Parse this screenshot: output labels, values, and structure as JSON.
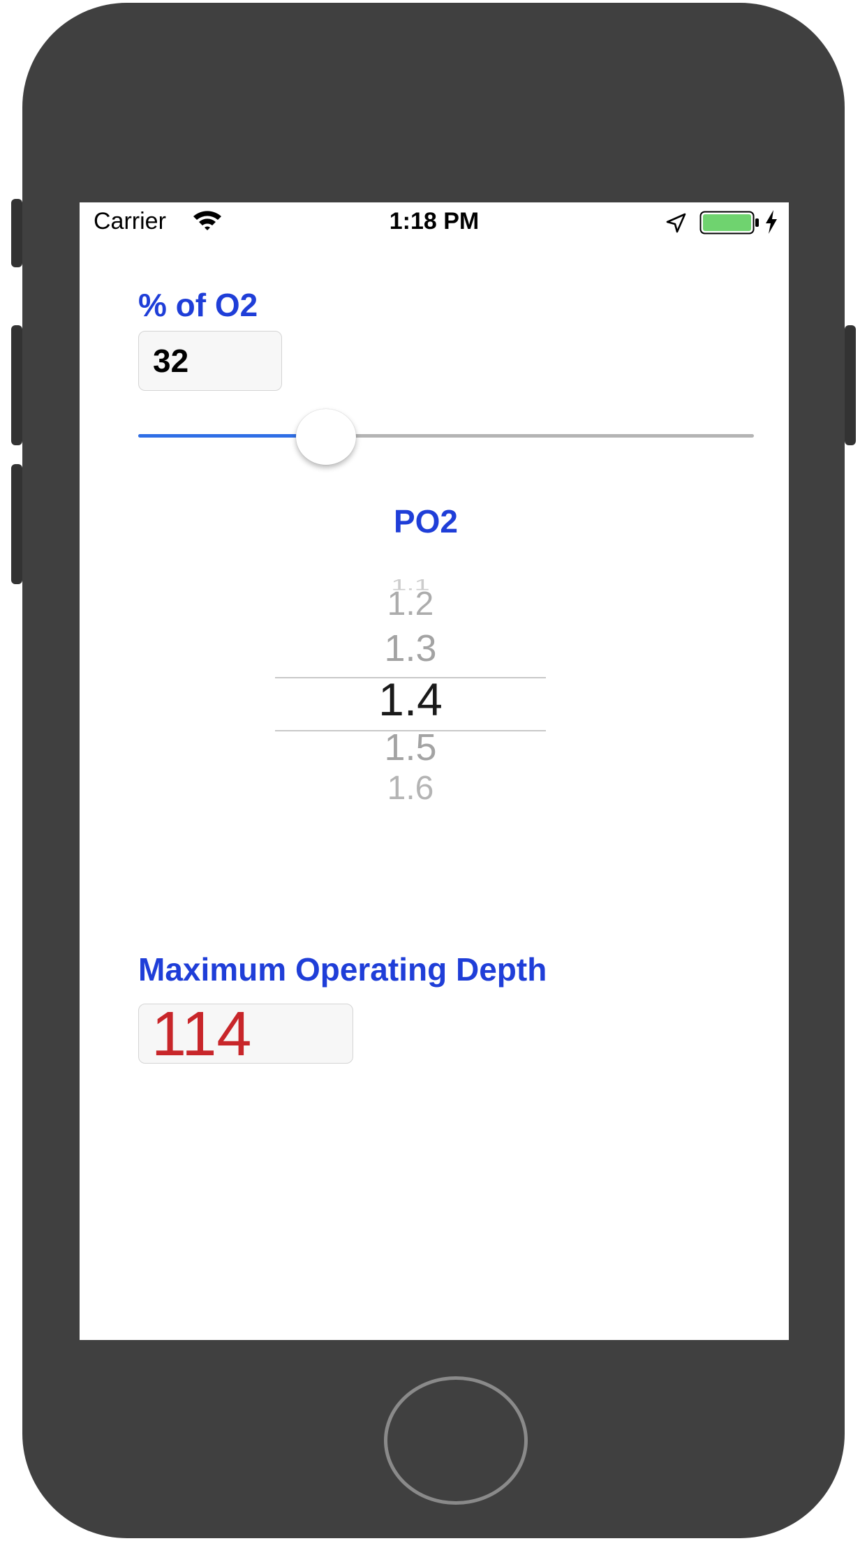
{
  "status_bar": {
    "carrier": "Carrier",
    "time": "1:18 PM",
    "icons": [
      "wifi-icon",
      "location-arrow-icon",
      "battery-icon",
      "charging-bolt-icon"
    ],
    "battery_color": "#6fd36f"
  },
  "o2": {
    "label": "% of O2",
    "value": "32",
    "slider_fraction": 0.284,
    "accent_color": "#2f6ee6"
  },
  "po2": {
    "label": "PO2",
    "options": [
      "1.1",
      "1.2",
      "1.3",
      "1.4",
      "1.5",
      "1.6"
    ],
    "selected": "1.4"
  },
  "mod": {
    "label": "Maximum Operating Depth",
    "value": "114",
    "value_color": "#c8262a"
  },
  "colors": {
    "label_blue": "#1f3ed8",
    "frame": "#404040"
  }
}
